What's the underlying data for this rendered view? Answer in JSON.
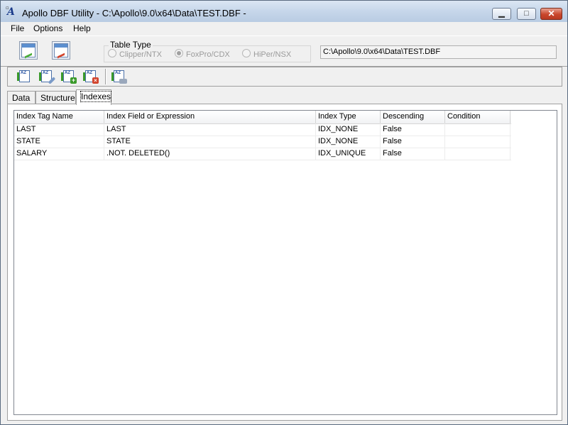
{
  "window": {
    "title": "Apollo DBF Utility  - C:\\Apollo\\9.0\\x64\\Data\\TEST.DBF -",
    "icon": "apollo-app-icon",
    "icon_letter": "A",
    "buttons": [
      "minimize",
      "maximize",
      "close"
    ]
  },
  "menu": {
    "file": "File",
    "options": "Options",
    "help": "Help"
  },
  "toolbar": {
    "table_type_label": "Table Type",
    "table_types": [
      {
        "label": "Clipper/NTX",
        "selected": false
      },
      {
        "label": "FoxPro/CDX",
        "selected": true
      },
      {
        "label": "HiPer/NSX",
        "selected": false
      }
    ],
    "path": "C:\\Apollo\\9.0\\x64\\Data\\TEST.DBF"
  },
  "index_toolbar": {
    "icons": [
      "index-sort-icon",
      "index-edit-icon",
      "index-add-icon",
      "index-delete-icon",
      "index-properties-icon"
    ]
  },
  "tabs": [
    {
      "label": "Data",
      "active": false
    },
    {
      "label": "Structure",
      "active": false
    },
    {
      "label": "Indexes",
      "active": true
    }
  ],
  "grid": {
    "columns": [
      "Index Tag Name",
      "Index Field or Expression",
      "Index Type",
      "Descending",
      "Condition"
    ],
    "rows": [
      [
        "LAST",
        "LAST",
        "IDX_NONE",
        "False",
        ""
      ],
      [
        "STATE",
        "STATE",
        "IDX_NONE",
        "False",
        ""
      ],
      [
        "SALARY",
        ".NOT. DELETED()",
        "IDX_UNIQUE",
        "False",
        ""
      ]
    ]
  },
  "colors": {
    "title_gradient_top": "#dbe6f3",
    "close_button": "#c9462c",
    "add_badge": "#3a9a2a",
    "delete_badge": "#d2452e"
  }
}
